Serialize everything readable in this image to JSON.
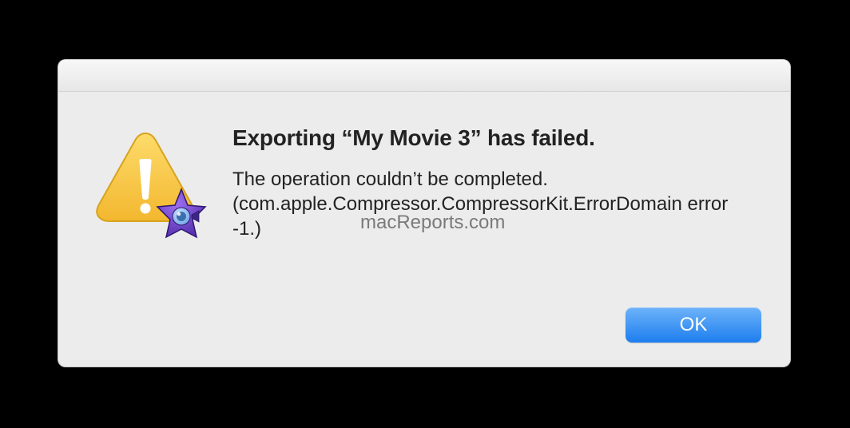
{
  "dialog": {
    "title": "Exporting “My Movie 3” has failed.",
    "message": "The operation couldn’t be completed. (com.apple.Compressor.CompressorKit.ErrorDomain error -1.)",
    "ok_label": "OK"
  },
  "watermark": "macReports.com",
  "icons": {
    "warning": "warning-icon",
    "app_badge": "imovie-icon"
  },
  "colors": {
    "warning_fill": "#f6c643",
    "warning_stroke": "#d7a31f",
    "accent_top": "#6db3fa",
    "accent_bottom": "#1d7eee",
    "star_fill": "#6a3fc7"
  }
}
